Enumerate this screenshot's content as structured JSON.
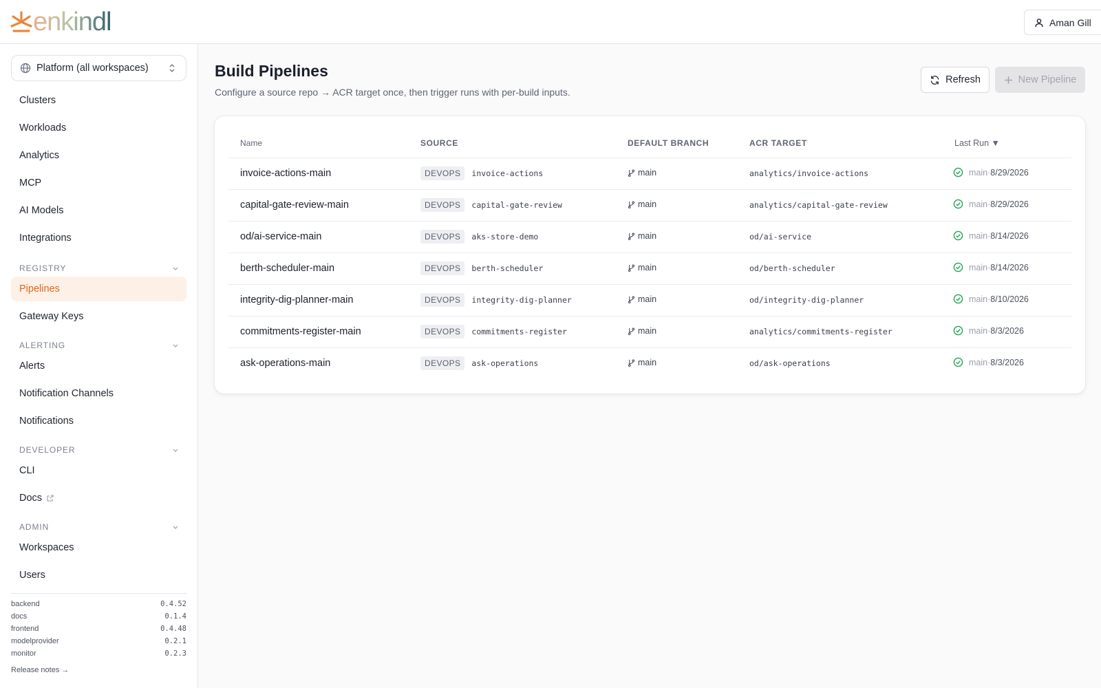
{
  "app": {
    "logo_text": "enkindl",
    "user_name": "Aman Gill",
    "colors": {
      "accent": "#e0671d",
      "success": "#22a355",
      "logo_gradient_start": "#e8883a",
      "logo_gradient_end": "#2f5f6b"
    }
  },
  "sidebar": {
    "workspace_selector": "Platform (all workspaces)",
    "top_items": [
      {
        "label": "Clusters"
      },
      {
        "label": "Workloads"
      },
      {
        "label": "Analytics"
      },
      {
        "label": "MCP"
      },
      {
        "label": "AI Models"
      },
      {
        "label": "Integrations"
      }
    ],
    "sections": {
      "registry": {
        "title": "REGISTRY",
        "items": [
          {
            "label": "Pipelines",
            "active": true
          },
          {
            "label": "Gateway Keys"
          }
        ]
      },
      "alerting": {
        "title": "ALERTING",
        "items": [
          {
            "label": "Alerts"
          },
          {
            "label": "Notification Channels"
          },
          {
            "label": "Notifications"
          }
        ]
      },
      "developer": {
        "title": "DEVELOPER",
        "items": [
          {
            "label": "CLI"
          },
          {
            "label": "Docs",
            "external_icon": "external-link-icon"
          }
        ]
      },
      "admin": {
        "title": "ADMIN",
        "items": [
          {
            "label": "Workspaces"
          },
          {
            "label": "Users"
          }
        ]
      }
    },
    "versions": [
      {
        "name": "backend",
        "version": "0.4.52"
      },
      {
        "name": "docs",
        "version": "0.1.4"
      },
      {
        "name": "frontend",
        "version": "0.4.48"
      },
      {
        "name": "modelprovider",
        "version": "0.2.1"
      },
      {
        "name": "monitor",
        "version": "0.2.3"
      }
    ],
    "release_notes": "Release notes →"
  },
  "main": {
    "title": "Build Pipelines",
    "subtitle": "Configure a source repo → ACR target once, then trigger runs with per-build inputs.",
    "refresh_label": "Refresh",
    "new_pipeline_label": "New Pipeline",
    "table": {
      "headers": {
        "name": "Name",
        "source": "SOURCE",
        "default_branch": "DEFAULT BRANCH",
        "acr_target": "ACR TARGET",
        "last_run": "Last Run ▼"
      },
      "rows": [
        {
          "name": "invoice-actions-main",
          "source_badge": "DEVOPS",
          "source_repo": "invoice-actions",
          "branch": "main",
          "acr": "analytics/invoice-actions",
          "last_branch": "main",
          "last_sep": " · ",
          "last_date": "8/29/2026"
        },
        {
          "name": "capital-gate-review-main",
          "source_badge": "DEVOPS",
          "source_repo": "capital-gate-review",
          "branch": "main",
          "acr": "analytics/capital-gate-review",
          "last_branch": "main",
          "last_sep": " · ",
          "last_date": "8/29/2026"
        },
        {
          "name": "od/ai-service-main",
          "source_badge": "DEVOPS",
          "source_repo": "aks-store-demo",
          "branch": "main",
          "acr": "od/ai-service",
          "last_branch": "main",
          "last_sep": " · ",
          "last_date": "8/14/2026"
        },
        {
          "name": "berth-scheduler-main",
          "source_badge": "DEVOPS",
          "source_repo": "berth-scheduler",
          "branch": "main",
          "acr": "od/berth-scheduler",
          "last_branch": "main",
          "last_sep": " · ",
          "last_date": "8/14/2026"
        },
        {
          "name": "integrity-dig-planner-main",
          "source_badge": "DEVOPS",
          "source_repo": "integrity-dig-planner",
          "branch": "main",
          "acr": "od/integrity-dig-planner",
          "last_branch": "main",
          "last_sep": " · ",
          "last_date": "8/10/2026"
        },
        {
          "name": "commitments-register-main",
          "source_badge": "DEVOPS",
          "source_repo": "commitments-register",
          "branch": "main",
          "acr": "analytics/commitments-register",
          "last_branch": "main",
          "last_sep": " · ",
          "last_date": "8/3/2026"
        },
        {
          "name": "ask-operations-main",
          "source_badge": "DEVOPS",
          "source_repo": "ask-operations",
          "branch": "main",
          "acr": "od/ask-operations",
          "last_branch": "main",
          "last_sep": " · ",
          "last_date": "8/3/2026"
        }
      ]
    }
  }
}
